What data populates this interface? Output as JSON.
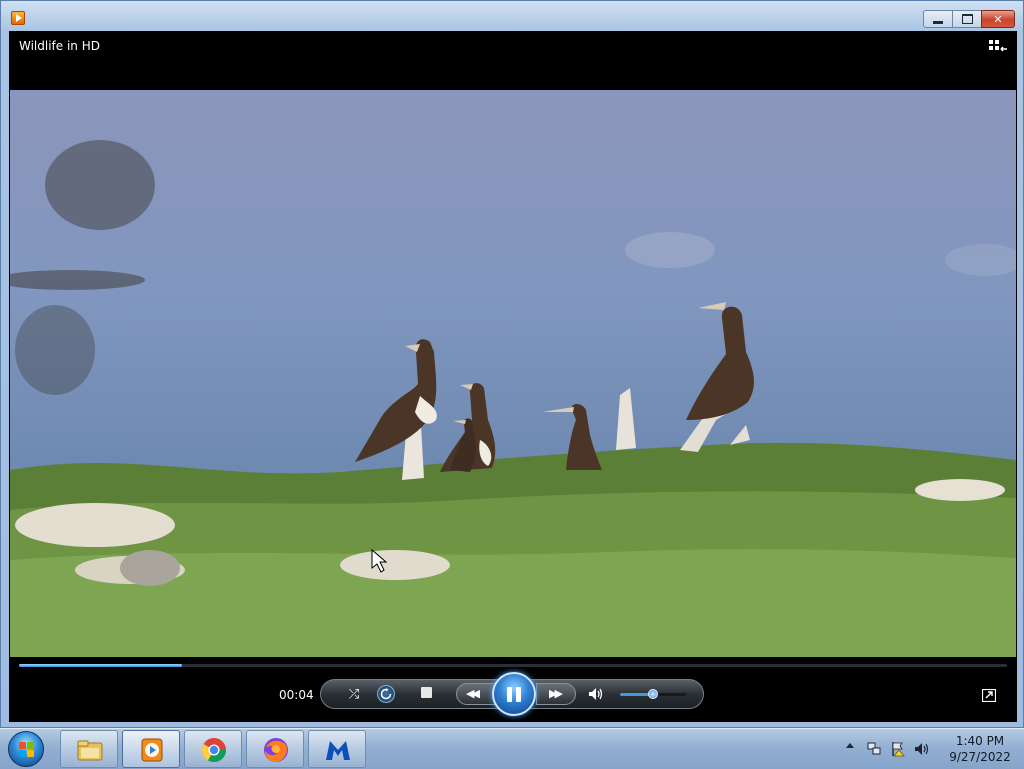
{
  "window": {
    "title": "",
    "minimize_symbol": "",
    "maximize_symbol": "",
    "close_symbol": "✕"
  },
  "player": {
    "media_title": "Wildlife in HD",
    "elapsed_time": "00:04",
    "progress_fraction": 0.165,
    "volume_fraction": 0.5,
    "state": "playing",
    "icons": {
      "library": "switch-to-library-icon",
      "shuffle": "shuffle-icon",
      "repeat": "repeat-icon",
      "stop": "stop-icon",
      "previous": "previous-icon",
      "play_pause": "pause-icon",
      "next": "next-icon",
      "volume": "speaker-icon",
      "switch_view": "switch-view-icon"
    },
    "glyphs": {
      "shuffle": "⤮",
      "previous": "◀◀",
      "next": "▶▶",
      "volume": "🔊"
    },
    "accent_color": "#3a8fd8"
  },
  "taskbar": {
    "items": [
      {
        "name": "windows-explorer",
        "icon": "folder-icon",
        "active": false
      },
      {
        "name": "windows-media-player",
        "icon": "media-player-icon",
        "active": true
      },
      {
        "name": "google-chrome",
        "icon": "chrome-icon",
        "active": false
      },
      {
        "name": "firefox",
        "icon": "firefox-icon",
        "active": false
      },
      {
        "name": "malwarebytes",
        "icon": "malwarebytes-icon",
        "active": false
      }
    ],
    "tray": {
      "icons": [
        "show-hidden-icons-icon",
        "network-icon",
        "action-center-flag-icon",
        "volume-icon"
      ],
      "time": "1:40 PM",
      "date": "9/27/2022"
    }
  }
}
